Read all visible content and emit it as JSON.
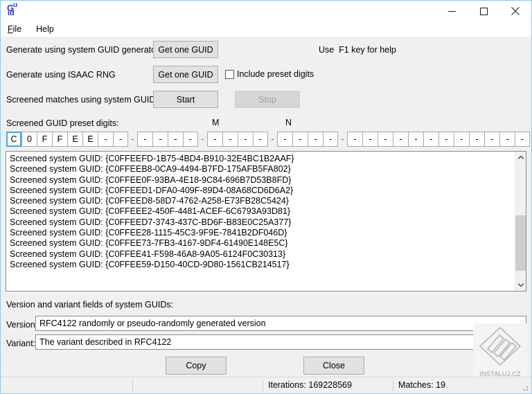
{
  "window": {
    "icon_top": "Gu",
    "icon_g": "G",
    "icon_u": "u",
    "icon_id": "id",
    "minimize_label": "Minimize",
    "maximize_label": "Maximize",
    "close_label": "Close",
    "border_color": "#8ec8ea"
  },
  "menu": {
    "items": [
      {
        "accel": "F",
        "rest": "ile"
      },
      {
        "accel": "",
        "rest": "Help"
      }
    ]
  },
  "controls": {
    "row1_label": "Generate using system GUID generator",
    "row1_button": "Get one GUID",
    "hint": "Use  F1 key for help",
    "row2_label": "Generate using ISAAC RNG",
    "row2_button": "Get one GUID",
    "checkbox_label": "Include preset digits",
    "checkbox_checked": false,
    "row3_label": "Screened matches using system GUIDs",
    "start_button": "Start",
    "stop_button": "Stop",
    "stop_disabled": true
  },
  "preset": {
    "title": "Screened GUID preset digits:",
    "label_m": "M",
    "label_n": "N",
    "separator": "-",
    "focused_index": 0,
    "groups": [
      [
        "C",
        "0",
        "F",
        "F",
        "E",
        "E",
        "-",
        "-"
      ],
      [
        "-",
        "-",
        "-",
        "-"
      ],
      [
        "-",
        "-",
        "-",
        "-"
      ],
      [
        "-",
        "-",
        "-",
        "-"
      ],
      [
        "-",
        "-",
        "-",
        "-",
        "-",
        "-",
        "-",
        "-",
        "-",
        "-",
        "-",
        "-"
      ]
    ]
  },
  "list": {
    "lines": [
      "Screened system GUID: {C0FFEEFD-1B75-4BD4-B910-32E4BC1B2AAF}",
      "Screened system GUID: {C0FFEEB8-0CA9-4494-B7FD-175AFB5FA802}",
      "Screened system GUID: {C0FFEE0F-93BA-4E18-9C84-696B7D53B8FD}",
      "Screened system GUID: {C0FFEED1-DFA0-409F-89D4-08A68CD6D6A2}",
      "Screened system GUID: {C0FFEED8-58D7-4762-A258-E73FB28C5424}",
      "Screened system GUID: {C0FFEEE2-450F-4481-ACEF-6C6793A93D81}",
      "Screened system GUID: {C0FFEED7-3743-437C-BD6F-B83E0C25A377}",
      "Screened system GUID: {C0FFEE28-1115-45C3-9F9E-7841B2DF046D}",
      "Screened system GUID: {C0FFEE73-7FB3-4167-9DF4-61490E148E5C}",
      "Screened system GUID: {C0FFEE41-F598-46A8-9A05-6124F0C30313}",
      "Screened system GUID: {C0FFEE59-D150-40CD-9D80-1561CB214517}"
    ],
    "scroll_up": "˄",
    "scroll_down": "˅"
  },
  "fields": {
    "section_title": "Version and variant fields of system GUIDs:",
    "version_label": "Version:",
    "version_value": "RFC4122 randomly or pseudo-randomly generated version",
    "variant_label": "Variant:",
    "variant_value": "The variant described in RFC4122"
  },
  "actions": {
    "copy": "Copy",
    "close": "Close"
  },
  "watermark": {
    "text": "INSTALUJ.CZ"
  },
  "statusbar": {
    "panel1": "",
    "panel2": "",
    "iterations": "Iterations: 169228569",
    "matches": "Matches: 19"
  }
}
